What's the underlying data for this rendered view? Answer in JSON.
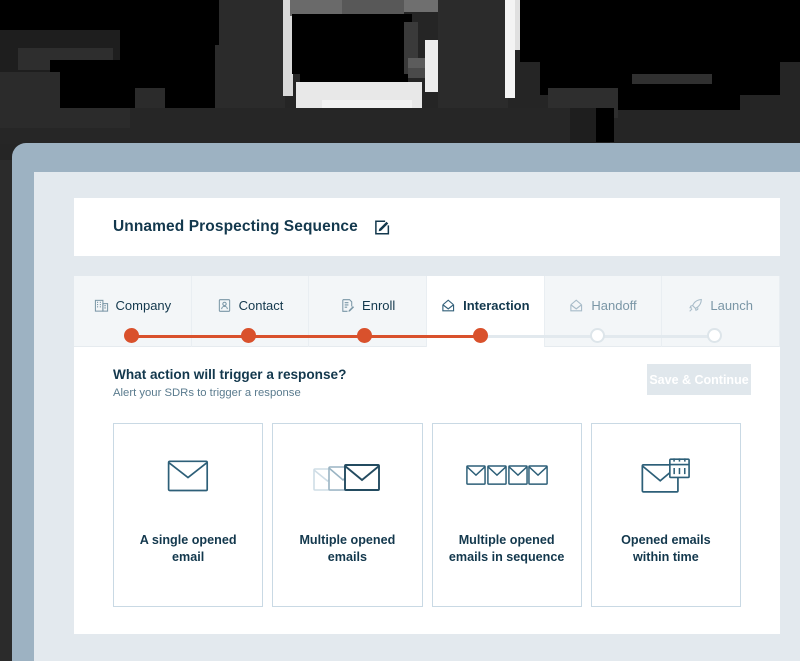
{
  "colors": {
    "accent_orange": "#d9512c",
    "dark_navy": "#13384d",
    "muted_blue": "#7a96a6",
    "frame_blue": "#9db2c2",
    "panel_bg": "#e3e9ee",
    "card_border": "#c9d9e4",
    "disabled_button": "#e0e7ec"
  },
  "header": {
    "title": "Unnamed Prospecting Sequence",
    "edit_icon": "edit-pencil-icon"
  },
  "stepper": {
    "steps": [
      {
        "label": "Company",
        "icon": "building-icon",
        "state": "done"
      },
      {
        "label": "Contact",
        "icon": "contact-card-icon",
        "state": "done"
      },
      {
        "label": "Enroll",
        "icon": "document-pen-icon",
        "state": "done"
      },
      {
        "label": "Interaction",
        "icon": "open-envelope-icon",
        "state": "active"
      },
      {
        "label": "Handoff",
        "icon": "open-envelope-icon",
        "state": "todo"
      },
      {
        "label": "Launch",
        "icon": "rocket-icon",
        "state": "todo"
      }
    ]
  },
  "content": {
    "question": "What action will trigger a response?",
    "subtitle": "Alert your SDRs to trigger a response",
    "save_label": "Save & Continue",
    "save_disabled": true,
    "options": [
      {
        "label": "A single opened email",
        "icon": "single-envelope-icon"
      },
      {
        "label": "Multiple opened emails",
        "icon": "stacked-envelopes-icon"
      },
      {
        "label": "Multiple opened emails in sequence",
        "icon": "envelope-row-icon"
      },
      {
        "label": "Opened emails within time",
        "icon": "envelope-calendar-icon"
      }
    ]
  }
}
